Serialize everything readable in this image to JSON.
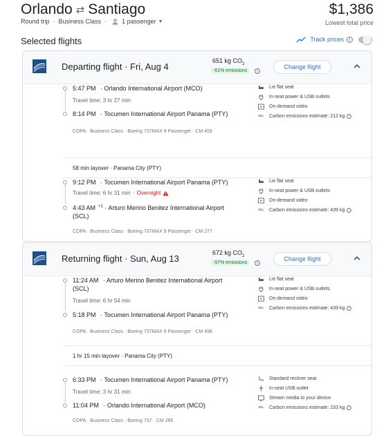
{
  "header": {
    "origin": "Orlando",
    "destination": "Santiago",
    "price": "$1,386",
    "price_label": "Lowest total price",
    "trip_type": "Round trip",
    "cabin": "Business Class",
    "passengers": "1 passenger"
  },
  "selected_title": "Selected flights",
  "track_prices": {
    "label": "Track prices",
    "enabled": false
  },
  "icons": {
    "swap": "swap-arrows-icon",
    "person": "person-icon",
    "track": "trend-icon",
    "airline": "copa-logo",
    "collapse": "chevron-up-icon"
  },
  "colors": {
    "accent": "#1a73e8",
    "emission_good": "#137333",
    "warning": "#c5221f"
  },
  "departing": {
    "title": "Departing flight",
    "date": "Fri, Aug 4",
    "co2": "651 kg CO",
    "co2_badge": "-61% emissions",
    "change_label": "Change flight",
    "segments": [
      {
        "dep_time": "5:47 PM",
        "dep_airport": "Orlando International Airport (MCO)",
        "travel_time": "Travel time: 3 hr 27 min",
        "arr_time": "8:14 PM",
        "arr_airport": "Tocumen International Airport Panama (PTY)",
        "meta": "COPA · Business Class · Boeing 737MAX 9 Passenger · CM 459",
        "amenities": [
          "Lie flat seat",
          "In-seat power & USB outlets",
          "On-demand video",
          "Carbon emissions estimate: 212 kg"
        ]
      },
      {
        "dep_time": "9:12 PM",
        "dep_airport": "Tocumen International Airport Panama (PTY)",
        "travel_time": "Travel time: 6 hr 31 min",
        "overnight": "Overnight",
        "arr_time": "4:43 AM",
        "arr_plus": "+1",
        "arr_airport": "Arturo Merino Benitez International Airport (SCL)",
        "meta": "COPA · Business Class · Boeing 737MAX 9 Passenger · CM 277",
        "amenities": [
          "Lie flat seat",
          "In-seat power & USB outlets",
          "On-demand video",
          "Carbon emissions estimate: 439 kg"
        ]
      }
    ],
    "layover": "58 min layover · Panama City (PTY)"
  },
  "returning": {
    "title": "Returning flight",
    "date": "Sun, Aug 13",
    "co2": "672 kg CO",
    "co2_badge": "-57% emissions",
    "change_label": "Change flight",
    "segments": [
      {
        "dep_time": "11:24 AM",
        "dep_airport": "Arturo Merino Benitez International Airport (SCL)",
        "travel_time": "Travel time: 6 hr 54 min",
        "arr_time": "5:18 PM",
        "arr_airport": "Tocumen International Airport Panama (PTY)",
        "meta": "COPA · Business Class · Boeing 737MAX 9 Passenger · CM 498",
        "amenities": [
          "Lie flat seat",
          "In-seat power & USB outlets",
          "On-demand video",
          "Carbon emissions estimate: 439 kg"
        ]
      },
      {
        "dep_time": "6:33 PM",
        "dep_airport": "Tocumen International Airport Panama (PTY)",
        "travel_time": "Travel time: 3 hr 31 min",
        "arr_time": "11:04 PM",
        "arr_airport": "Orlando International Airport (MCO)",
        "meta": "COPA · Business Class · Boeing 737 · CM 285",
        "amenities": [
          "Standard recliner seat",
          "In-seat USB outlet",
          "Stream media to your device",
          "Carbon emissions estimate: 233 kg"
        ]
      }
    ],
    "layover": "1 hr 15 min layover · Panama City (PTY)"
  }
}
